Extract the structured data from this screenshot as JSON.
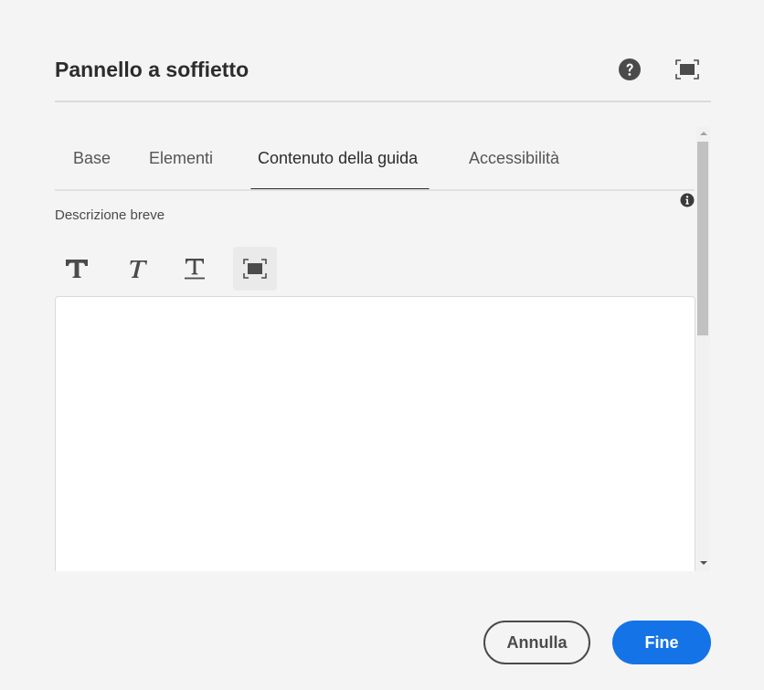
{
  "dialog": {
    "title": "Pannello a soffietto"
  },
  "header": {
    "help_icon": "help-circle-icon",
    "fullscreen_icon": "fullscreen-icon"
  },
  "tabs": [
    {
      "label": "Base",
      "active": false
    },
    {
      "label": "Elementi",
      "active": false
    },
    {
      "label": "Contenuto della guida",
      "active": true
    },
    {
      "label": "Accessibilità",
      "active": false
    }
  ],
  "field": {
    "label": "Descrizione breve",
    "value": ""
  },
  "toolbar": {
    "buttons": [
      {
        "icon": "bold-icon",
        "selected": false
      },
      {
        "icon": "italic-icon",
        "selected": false
      },
      {
        "icon": "underline-icon",
        "selected": false
      },
      {
        "icon": "fullscreen-icon",
        "selected": true
      }
    ]
  },
  "footer": {
    "cancel_label": "Annulla",
    "done_label": "Fine"
  },
  "colors": {
    "accent": "#1473e6",
    "background": "#f4f4f4",
    "text": "#2c2c2c"
  }
}
